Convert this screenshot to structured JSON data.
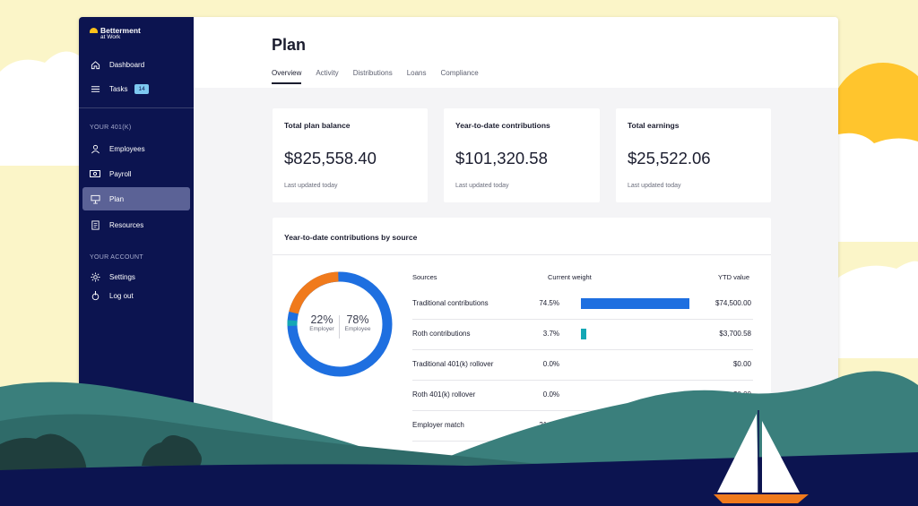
{
  "brand": {
    "name": "Betterment",
    "sub": "at Work",
    "mark_color": "#ffc21a"
  },
  "sidebar": {
    "items_top": [
      {
        "label": "Dashboard",
        "icon": "home-icon"
      },
      {
        "label": "Tasks",
        "icon": "list-icon",
        "badge": "14"
      }
    ],
    "section_401k": "YOUR 401(K)",
    "items_401k": [
      {
        "label": "Employees",
        "icon": "person-icon"
      },
      {
        "label": "Payroll",
        "icon": "cash-icon"
      },
      {
        "label": "Plan",
        "icon": "presentation-icon",
        "active": true
      },
      {
        "label": "Resources",
        "icon": "book-icon"
      }
    ],
    "section_account": "YOUR ACCOUNT",
    "items_account": [
      {
        "label": "Settings",
        "icon": "gear-icon"
      },
      {
        "label": "Log out",
        "icon": "logout-icon"
      }
    ]
  },
  "page": {
    "title": "Plan",
    "tabs": [
      "Overview",
      "Activity",
      "Distributions",
      "Loans",
      "Compliance"
    ],
    "active_tab": "Overview"
  },
  "summary_cards": [
    {
      "title": "Total plan balance",
      "value": "$825,558.40",
      "footnote": "Last updated today"
    },
    {
      "title": "Year-to-date contributions",
      "value": "$101,320.58",
      "footnote": "Last updated today"
    },
    {
      "title": "Total earnings",
      "value": "$25,522.06",
      "footnote": "Last updated today"
    }
  ],
  "contributions": {
    "title": "Year-to-date contributions by source",
    "donut": {
      "employer_pct": "22%",
      "employer_label": "Employer",
      "employee_pct": "78%",
      "employee_label": "Employee"
    },
    "columns": {
      "source": "Sources",
      "weight": "Current weight",
      "ytd": "YTD value"
    },
    "rows": [
      {
        "source": "Traditional contributions",
        "weight": "74.5%",
        "weight_value": 74.5,
        "ytd": "$74,500.00",
        "color": "#1e6fe0"
      },
      {
        "source": "Roth contributions",
        "weight": "3.7%",
        "weight_value": 3.7,
        "ytd": "$3,700.58",
        "color": "#13a7b5"
      },
      {
        "source": "Traditional 401(k) rollover",
        "weight": "0.0%",
        "weight_value": 0,
        "ytd": "$0.00",
        "color": "#1e6fe0"
      },
      {
        "source": "Roth 401(k) rollover",
        "weight": "0.0%",
        "weight_value": 0,
        "ytd": "$0.00",
        "color": "#1e6fe0"
      },
      {
        "source": "Employer match",
        "weight": "21.8%",
        "weight_value": 21.8,
        "ytd": "",
        "color": "#f07a1c"
      }
    ]
  },
  "colors": {
    "navy": "#0c1450",
    "blue": "#1e6fe0",
    "teal": "#13a7b5",
    "orange": "#f07a1c"
  }
}
